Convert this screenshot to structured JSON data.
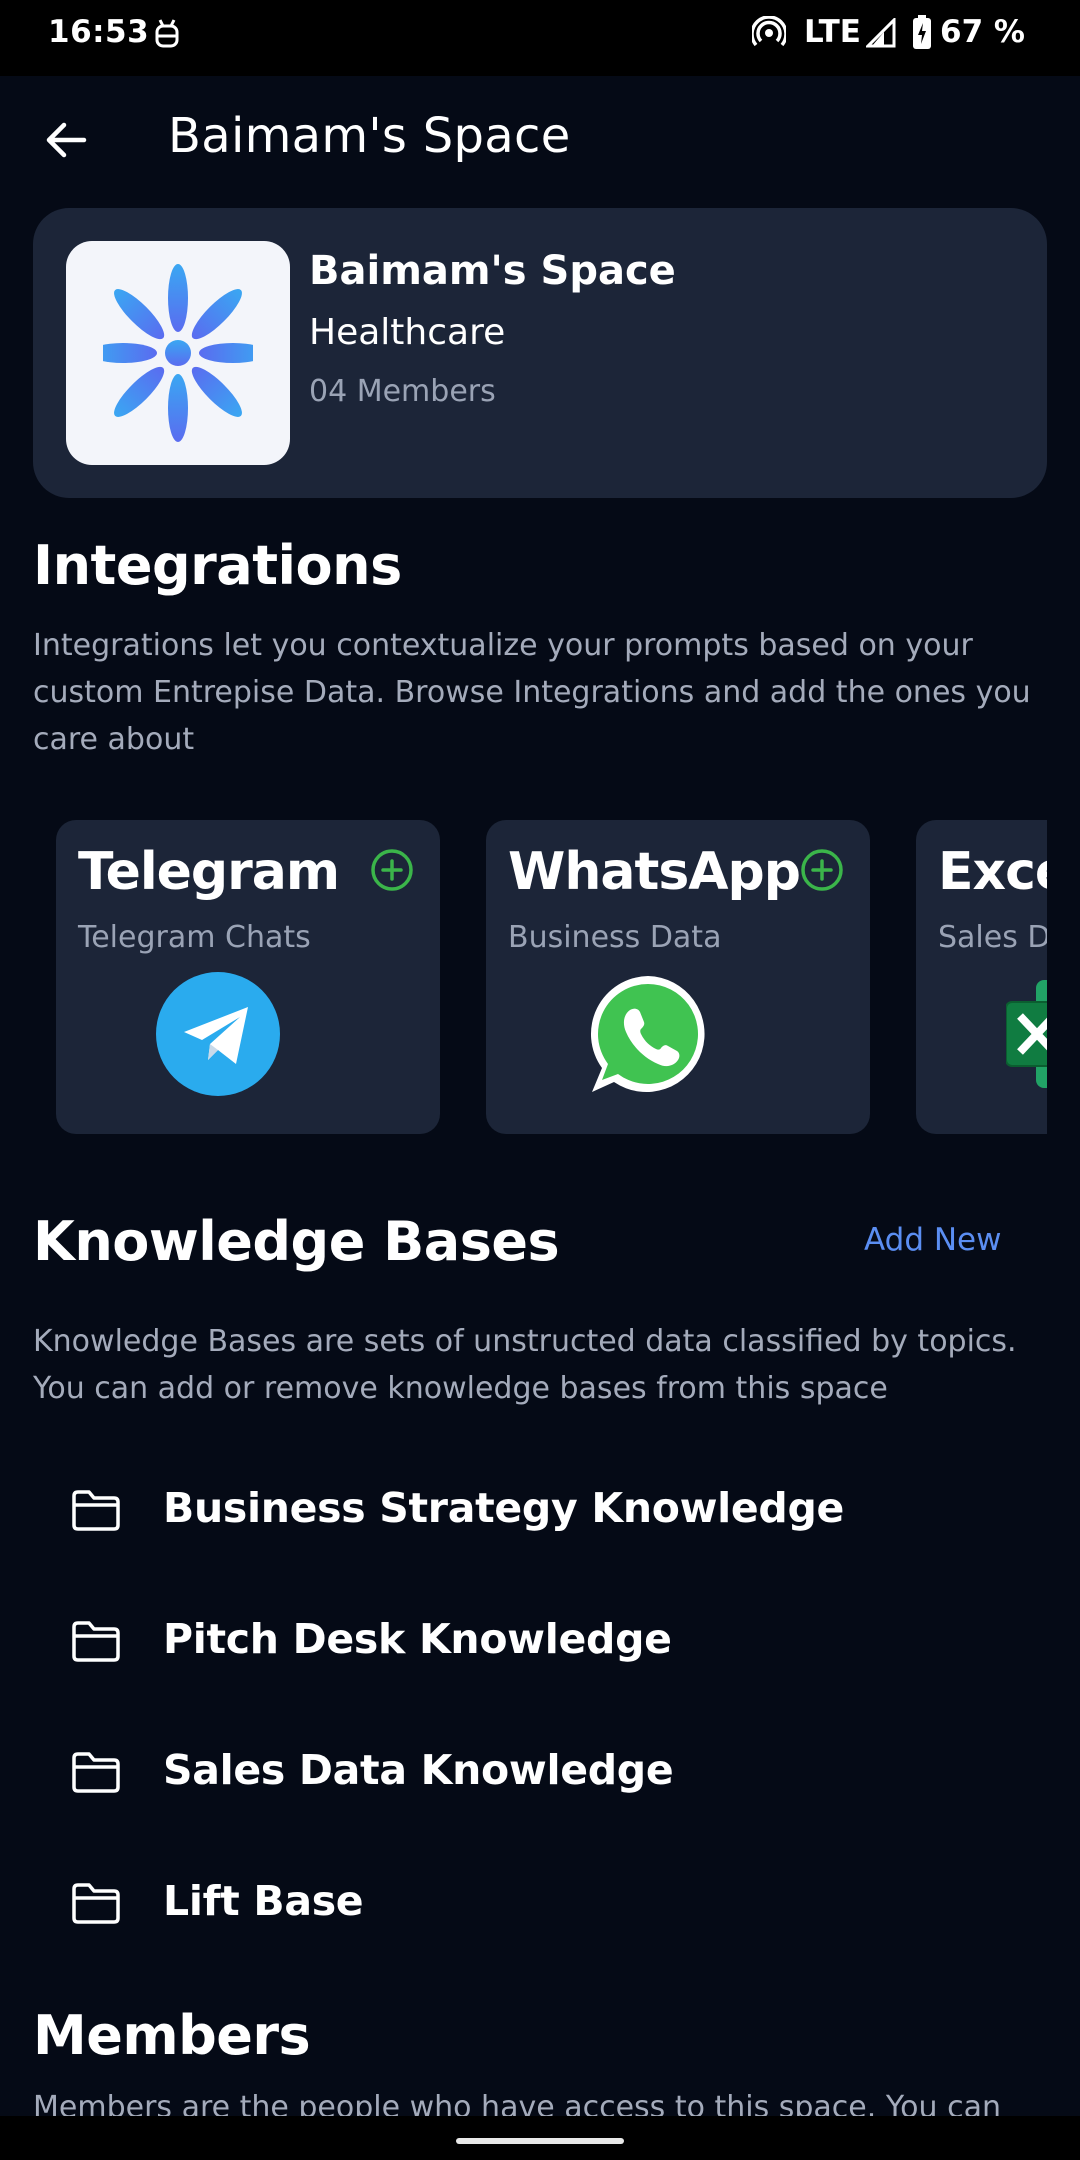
{
  "status_bar": {
    "time": "16:53",
    "network": "LTE",
    "battery": "67 %",
    "icons": [
      "android-debug-icon",
      "hotspot-icon",
      "signal-icon",
      "battery-icon"
    ]
  },
  "header": {
    "title": "Baimam's Space",
    "back_icon": "arrow-left-icon"
  },
  "space": {
    "name": "Baimam's Space",
    "category": "Healthcare",
    "members": "04 Members",
    "logo_icon": "asterisk-flower-icon",
    "logo_color": "#3f86f0"
  },
  "integrations": {
    "title": "Integrations",
    "description": "Integrations let you contextualize your prompts based on your custom Entrepise Data. Browse Integrations and add the ones you care about",
    "items": [
      {
        "name": "Telegram",
        "subtitle": "Telegram Chats",
        "icon": "telegram-icon",
        "add_icon": "plus-circle-icon"
      },
      {
        "name": "WhatsApp",
        "subtitle": "Business Data",
        "icon": "whatsapp-icon",
        "add_icon": "plus-circle-icon"
      },
      {
        "name": "Exce",
        "subtitle": "Sales D",
        "icon": "excel-icon",
        "add_icon": "plus-circle-icon"
      }
    ]
  },
  "knowledge": {
    "title": "Knowledge Bases",
    "add_new": "Add New",
    "description": "Knowledge Bases are sets of unstructed data classified by topics. You can add or remove knowledge bases from this space",
    "items": [
      {
        "label": "Business Strategy Knowledge",
        "icon": "folder-icon"
      },
      {
        "label": "Pitch Desk Knowledge",
        "icon": "folder-icon"
      },
      {
        "label": "Sales Data Knowledge",
        "icon": "folder-icon"
      },
      {
        "label": "Lift Base",
        "icon": "folder-icon"
      }
    ]
  },
  "members": {
    "title": "Members",
    "description": "Members are the people who have access to this space. You can"
  },
  "colors": {
    "background": "#050a16",
    "card": "#1c2538",
    "accent_green": "#3bb54a",
    "link_blue": "#5b8ef2",
    "muted_text": "#a4abbb"
  }
}
